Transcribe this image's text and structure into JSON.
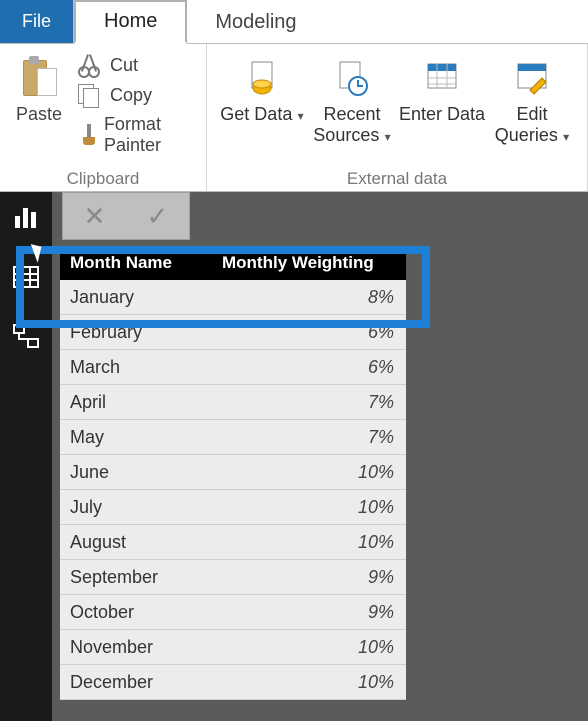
{
  "tabs": {
    "file": "File",
    "home": "Home",
    "modeling": "Modeling"
  },
  "ribbon": {
    "clipboard": {
      "group_label": "Clipboard",
      "paste": "Paste",
      "cut": "Cut",
      "copy": "Copy",
      "format_painter": "Format Painter"
    },
    "external": {
      "group_label": "External data",
      "get_data": "Get Data",
      "recent_sources": "Recent Sources",
      "enter_data": "Enter Data",
      "edit_queries": "Edit Queries"
    }
  },
  "table": {
    "headers": {
      "month": "Month Name",
      "weighting": "Monthly Weighting"
    },
    "rows": [
      {
        "month": "January",
        "value": "8%"
      },
      {
        "month": "February",
        "value": "6%"
      },
      {
        "month": "March",
        "value": "6%"
      },
      {
        "month": "April",
        "value": "7%"
      },
      {
        "month": "May",
        "value": "7%"
      },
      {
        "month": "June",
        "value": "10%"
      },
      {
        "month": "July",
        "value": "10%"
      },
      {
        "month": "August",
        "value": "10%"
      },
      {
        "month": "September",
        "value": "9%"
      },
      {
        "month": "October",
        "value": "9%"
      },
      {
        "month": "November",
        "value": "10%"
      },
      {
        "month": "December",
        "value": "10%"
      }
    ]
  },
  "chart_data": {
    "type": "table",
    "title": "Monthly Weighting",
    "columns": [
      "Month Name",
      "Monthly Weighting"
    ],
    "categories": [
      "January",
      "February",
      "March",
      "April",
      "May",
      "June",
      "July",
      "August",
      "September",
      "October",
      "November",
      "December"
    ],
    "values": [
      8,
      6,
      6,
      7,
      7,
      10,
      10,
      10,
      9,
      9,
      10,
      10
    ],
    "unit": "%"
  }
}
